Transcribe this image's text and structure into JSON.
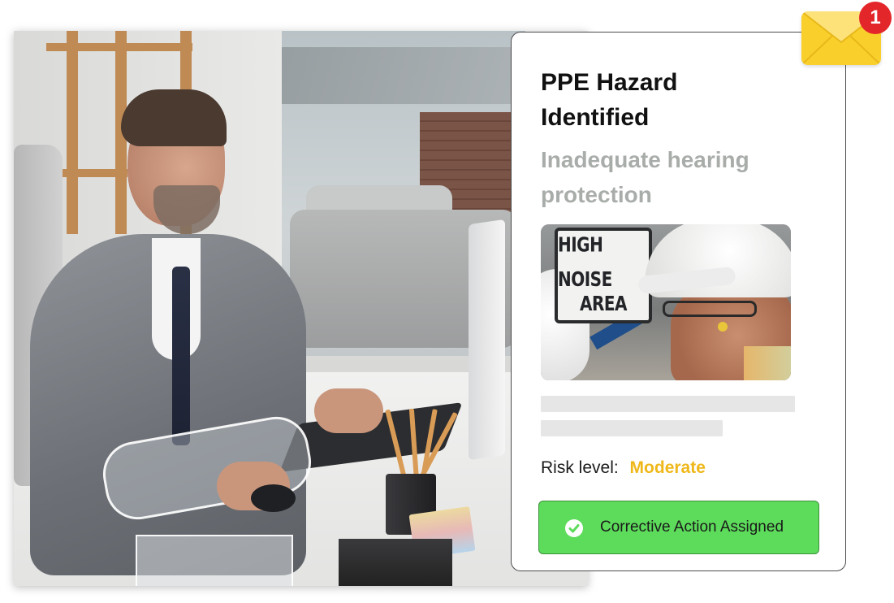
{
  "notification": {
    "icon": "envelope-icon",
    "badge_count": "1",
    "envelope_color": "#f9cf2b",
    "badge_color": "#e3262a"
  },
  "photo": {
    "description_icon": "office-worker-photo"
  },
  "card": {
    "title": "PPE Hazard Identified",
    "subtitle": "Inadequate hearing protection",
    "image": {
      "sign_line_1": "HIGH NOISE",
      "sign_line_2": "AREA"
    },
    "risk": {
      "label": "Risk level:",
      "value": "Moderate",
      "value_color": "#efb81a"
    },
    "action": {
      "icon": "checkmark-icon",
      "label": "Corrective Action Assigned",
      "color": "#5ddc5b"
    }
  }
}
